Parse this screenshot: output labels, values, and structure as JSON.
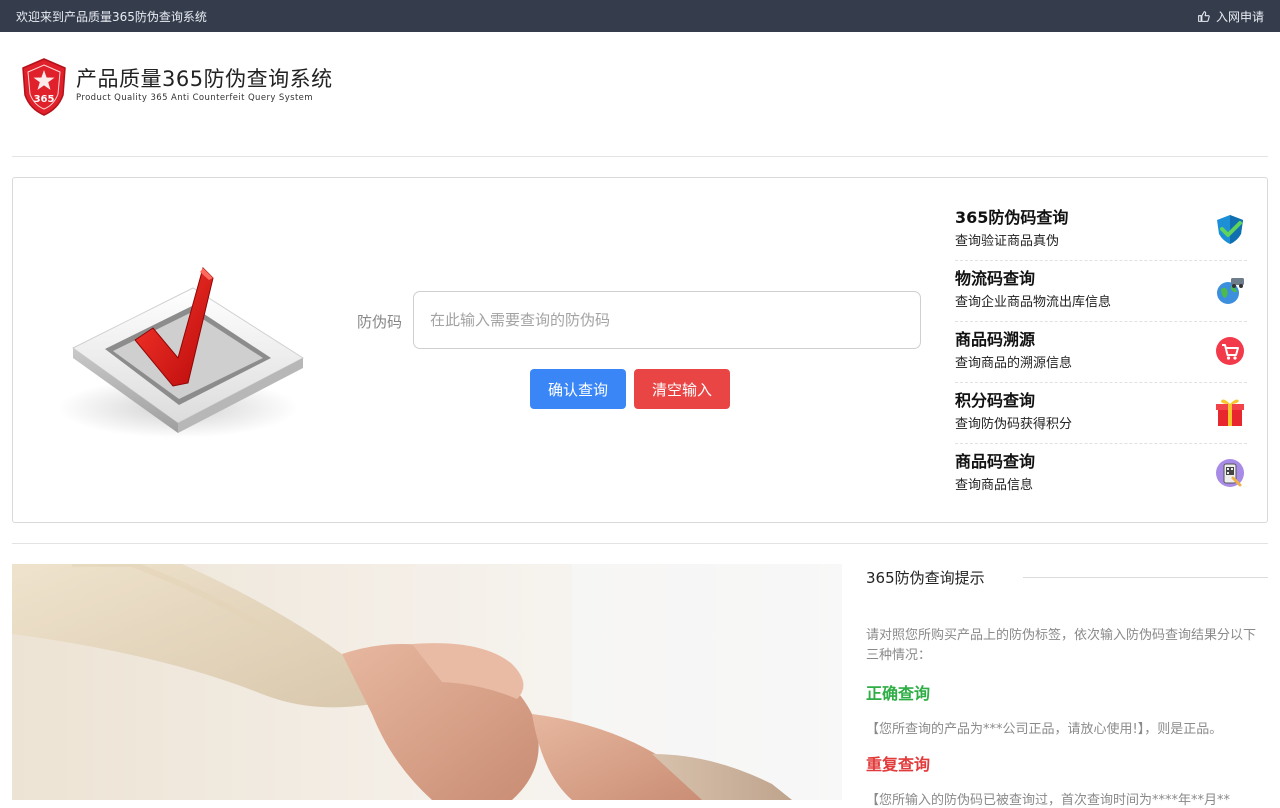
{
  "topbar": {
    "welcome": "欢迎来到产品质量365防伪查询系统",
    "join_label": "入网申请",
    "join_icon": "thumbs-up-icon"
  },
  "brand": {
    "title": "产品质量365防伪查询系统",
    "subtitle": "Product Quality 365 Anti Counterfeit Query System",
    "logo_text": "365",
    "logo_color": "#e0202a"
  },
  "query": {
    "label": "防伪码",
    "placeholder": "在此输入需要查询的防伪码",
    "value": "",
    "confirm_label": "确认查询",
    "clear_label": "清空输入",
    "confirm_color": "#3a86f7",
    "clear_color": "#ea4545"
  },
  "services": [
    {
      "title": "365防伪码查询",
      "desc": "查询验证商品真伪",
      "icon": "shield-check-icon"
    },
    {
      "title": "物流码查询",
      "desc": "查询企业商品物流出库信息",
      "icon": "globe-logistics-icon"
    },
    {
      "title": "商品码溯源",
      "desc": "查询商品的溯源信息",
      "icon": "shopping-cart-icon"
    },
    {
      "title": "积分码查询",
      "desc": "查询防伪码获得积分",
      "icon": "gift-icon"
    },
    {
      "title": "商品码查询",
      "desc": "查询商品信息",
      "icon": "scan-phone-icon"
    }
  ],
  "tips": {
    "title": "365防伪查询提示",
    "intro": "请对照您所购买产品上的防伪标签，依次输入防伪码查询结果分以下三种情况：",
    "case1_title": "正确查询",
    "case1_text": "【您所查询的产品为***公司正品，请放心使用!】，则是正品。",
    "case2_title": "重复查询",
    "case2_text": "【您所输入的防伪码已被查询过，首次查询时间为****年**月**"
  }
}
